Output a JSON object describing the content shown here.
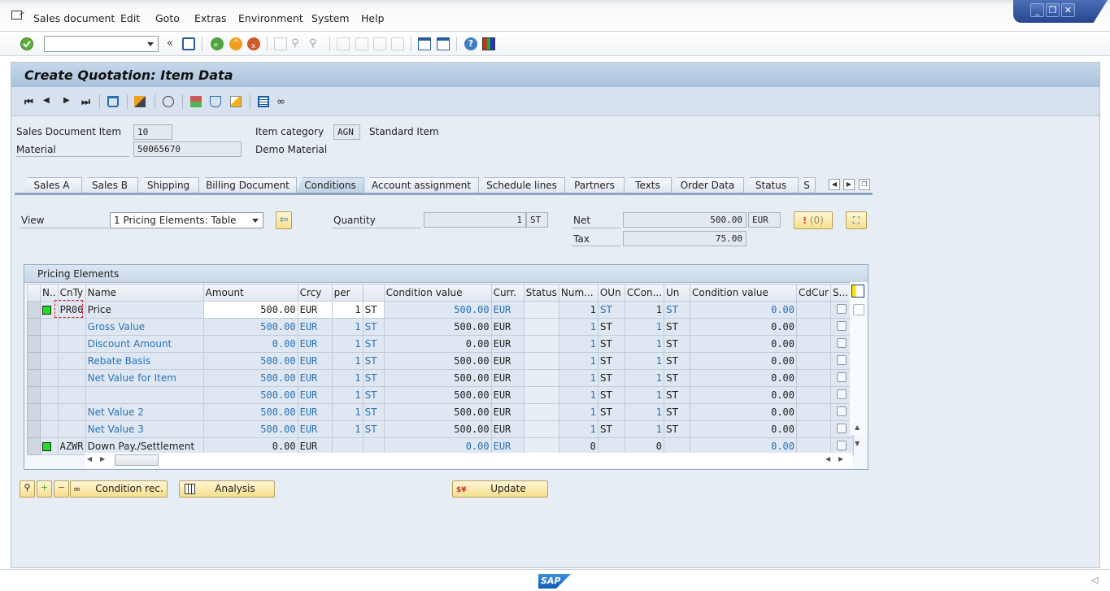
{
  "menubar": {
    "items": [
      {
        "label": "Sales document",
        "accel": "S"
      },
      {
        "label": "Edit",
        "accel": "E"
      },
      {
        "label": "Goto",
        "accel": "G"
      },
      {
        "label": "Extras",
        "accel": "r"
      },
      {
        "label": "Environment",
        "accel": "v"
      },
      {
        "label": "System",
        "accel": "y"
      },
      {
        "label": "Help",
        "accel": "H"
      }
    ],
    "window_controls": {
      "minimize": "_",
      "restore": "❐",
      "close": "✕"
    }
  },
  "toolbar": {
    "command_field_value": "",
    "icons": [
      "enter-icon",
      "save-icon",
      "back-icon",
      "exit-icon",
      "cancel-icon",
      "print-icon",
      "find-icon",
      "find-next-icon",
      "first-page-icon",
      "previous-page-icon",
      "next-page-icon",
      "last-page-icon",
      "create-session-icon",
      "shortcut-icon",
      "help-icon",
      "customize-layout-icon"
    ]
  },
  "page": {
    "title": "Create Quotation: Item Data"
  },
  "header": {
    "sales_doc_item_label": "Sales Document Item",
    "sales_doc_item_value": "10",
    "material_label": "Material",
    "material_value": "50065670",
    "item_category_label": "Item category",
    "item_category_value": "AGN",
    "item_category_desc": "Standard Item",
    "material_desc": "Demo Material"
  },
  "tabs": [
    {
      "label": "Sales A"
    },
    {
      "label": "Sales B"
    },
    {
      "label": "Shipping"
    },
    {
      "label": "Billing Document"
    },
    {
      "label": "Conditions",
      "active": true
    },
    {
      "label": "Account assignment"
    },
    {
      "label": "Schedule lines"
    },
    {
      "label": "Partners"
    },
    {
      "label": "Texts"
    },
    {
      "label": "Order Data"
    },
    {
      "label": "Status"
    },
    {
      "label": "S"
    }
  ],
  "conditions": {
    "view_label": "View",
    "view_value": "1 Pricing Elements: Table",
    "quantity_label": "Quantity",
    "quantity_value": "1",
    "quantity_unit": "ST",
    "net_label": "Net",
    "net_value": "500.00",
    "net_currency": "EUR",
    "tax_label": "Tax",
    "tax_value": "75.00",
    "messages_count": "(0)"
  },
  "grid": {
    "title": "Pricing Elements",
    "columns": [
      "N..",
      "CnTy",
      "Name",
      "Amount",
      "Crcy",
      "per",
      "",
      "Condition value",
      "Curr.",
      "Status",
      "Num...",
      "OUn",
      "CCon...",
      "Un",
      "Condition value",
      "CdCur",
      "S..."
    ],
    "rows": [
      {
        "status": true,
        "cnty": "PR00",
        "name": "Price",
        "amount": "500.00",
        "crcy": "EUR",
        "per": "1",
        "uom": "ST",
        "cond_value": "500.00",
        "curr": "EUR",
        "cstatus": "",
        "num": "1",
        "oun": "ST",
        "ccon": "1",
        "un": "ST",
        "cond_value2": "0.00",
        "cdcur": ""
      },
      {
        "status": false,
        "cnty": "",
        "name": "Gross Value",
        "amount": "500.00",
        "crcy": "EUR",
        "per": "1",
        "uom": "ST",
        "cond_value": "500.00",
        "curr": "EUR",
        "cstatus": "",
        "num": "1",
        "oun": "ST",
        "ccon": "1",
        "un": "ST",
        "cond_value2": "0.00",
        "cdcur": ""
      },
      {
        "status": false,
        "cnty": "",
        "name": "Discount Amount",
        "amount": "0.00",
        "crcy": "EUR",
        "per": "1",
        "uom": "ST",
        "cond_value": "0.00",
        "curr": "EUR",
        "cstatus": "",
        "num": "1",
        "oun": "ST",
        "ccon": "1",
        "un": "ST",
        "cond_value2": "0.00",
        "cdcur": ""
      },
      {
        "status": false,
        "cnty": "",
        "name": "Rebate Basis",
        "amount": "500.00",
        "crcy": "EUR",
        "per": "1",
        "uom": "ST",
        "cond_value": "500.00",
        "curr": "EUR",
        "cstatus": "",
        "num": "1",
        "oun": "ST",
        "ccon": "1",
        "un": "ST",
        "cond_value2": "0.00",
        "cdcur": ""
      },
      {
        "status": false,
        "cnty": "",
        "name": "Net Value for Item",
        "amount": "500.00",
        "crcy": "EUR",
        "per": "1",
        "uom": "ST",
        "cond_value": "500.00",
        "curr": "EUR",
        "cstatus": "",
        "num": "1",
        "oun": "ST",
        "ccon": "1",
        "un": "ST",
        "cond_value2": "0.00",
        "cdcur": ""
      },
      {
        "status": false,
        "cnty": "",
        "name": "",
        "amount": "500.00",
        "crcy": "EUR",
        "per": "1",
        "uom": "ST",
        "cond_value": "500.00",
        "curr": "EUR",
        "cstatus": "",
        "num": "1",
        "oun": "ST",
        "ccon": "1",
        "un": "ST",
        "cond_value2": "0.00",
        "cdcur": ""
      },
      {
        "status": false,
        "cnty": "",
        "name": "Net Value 2",
        "amount": "500.00",
        "crcy": "EUR",
        "per": "1",
        "uom": "ST",
        "cond_value": "500.00",
        "curr": "EUR",
        "cstatus": "",
        "num": "1",
        "oun": "ST",
        "ccon": "1",
        "un": "ST",
        "cond_value2": "0.00",
        "cdcur": ""
      },
      {
        "status": false,
        "cnty": "",
        "name": "Net Value 3",
        "amount": "500.00",
        "crcy": "EUR",
        "per": "1",
        "uom": "ST",
        "cond_value": "500.00",
        "curr": "EUR",
        "cstatus": "",
        "num": "1",
        "oun": "ST",
        "ccon": "1",
        "un": "ST",
        "cond_value2": "0.00",
        "cdcur": ""
      },
      {
        "status": true,
        "cnty": "AZWR",
        "name": "Down Pay./Settlement",
        "amount": "0.00",
        "crcy": "EUR",
        "per": "",
        "uom": "",
        "cond_value": "0.00",
        "curr": "EUR",
        "cstatus": "",
        "num": "0",
        "oun": "",
        "ccon": "0",
        "un": "",
        "cond_value2": "0.00",
        "cdcur": ""
      }
    ]
  },
  "buttons": {
    "condition_rec": "Condition rec.",
    "analysis": "Analysis",
    "update": "Update"
  },
  "statusbar": {
    "logo": "SAP"
  },
  "colors": {
    "accent_blue": "#2b72b5",
    "status_green": "#1ee01e",
    "button_yellow": "#f7df8e"
  }
}
